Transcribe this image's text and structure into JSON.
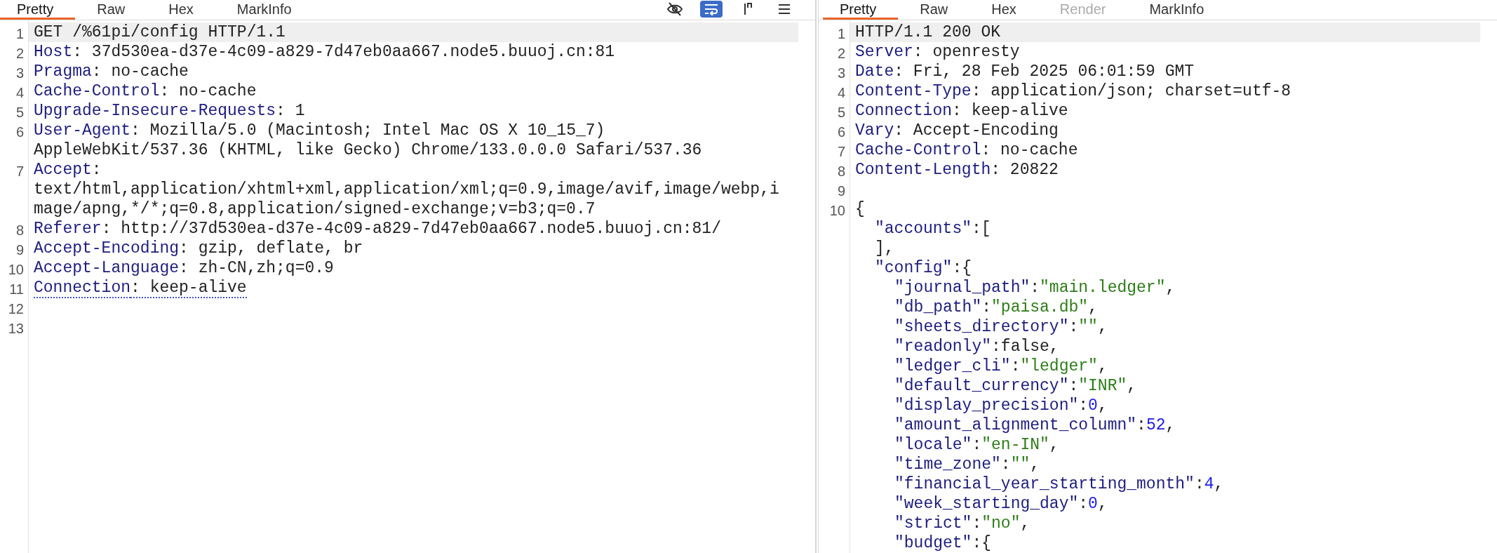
{
  "request": {
    "tabs": [
      {
        "label": "Pretty",
        "selected": true,
        "disabled": false
      },
      {
        "label": "Raw",
        "selected": false,
        "disabled": false
      },
      {
        "label": "Hex",
        "selected": false,
        "disabled": false
      },
      {
        "label": "MarkInfo",
        "selected": false,
        "disabled": false
      }
    ],
    "toolbar": [
      {
        "kind": "hide",
        "on": false
      },
      {
        "kind": "wrap",
        "on": true
      },
      {
        "kind": "newline",
        "on": false
      },
      {
        "kind": "menu",
        "on": false
      }
    ],
    "lines": [
      {
        "number": "1",
        "current": true,
        "underlined": false,
        "tokens": [
          {
            "text": "GET /%61pi/config HTTP/1.1",
            "kind": "plain"
          }
        ]
      },
      {
        "number": "2",
        "current": false,
        "underlined": false,
        "tokens": [
          {
            "text": "Host",
            "kind": "key"
          },
          {
            "text": ": 37d530ea-d37e-4c09-a829-7d47eb0aa667.node5.buuoj.cn:81",
            "kind": "plain"
          }
        ]
      },
      {
        "number": "3",
        "current": false,
        "underlined": false,
        "tokens": [
          {
            "text": "Pragma",
            "kind": "key"
          },
          {
            "text": ": no-cache",
            "kind": "plain"
          }
        ]
      },
      {
        "number": "4",
        "current": false,
        "underlined": false,
        "tokens": [
          {
            "text": "Cache-Control",
            "kind": "key"
          },
          {
            "text": ": no-cache",
            "kind": "plain"
          }
        ]
      },
      {
        "number": "5",
        "current": false,
        "underlined": false,
        "tokens": [
          {
            "text": "Upgrade-Insecure-Requests",
            "kind": "key"
          },
          {
            "text": ": 1",
            "kind": "plain"
          }
        ]
      },
      {
        "number": "6",
        "current": false,
        "underlined": false,
        "tokens": [
          {
            "text": "User-Agent",
            "kind": "key"
          },
          {
            "text": ": Mozilla/5.0 (Macintosh; Intel Mac OS X 10_15_7) AppleWebKit/537.36 (KHTML, like Gecko) Chrome/133.0.0.0 Safari/537.36",
            "kind": "plain"
          }
        ]
      },
      {
        "number": "7",
        "current": false,
        "underlined": false,
        "tokens": [
          {
            "text": "Accept",
            "kind": "key"
          },
          {
            "text": ": text/html,application/xhtml+xml,application/xml;q=0.9,image/avif,image/webp,image/apng,*/*;q=0.8,application/signed-exchange;v=b3;q=0.7",
            "kind": "plain"
          }
        ]
      },
      {
        "number": "8",
        "current": false,
        "underlined": false,
        "tokens": [
          {
            "text": "Referer",
            "kind": "key"
          },
          {
            "text": ": http://37d530ea-d37e-4c09-a829-7d47eb0aa667.node5.buuoj.cn:81/",
            "kind": "plain"
          }
        ]
      },
      {
        "number": "9",
        "current": false,
        "underlined": false,
        "tokens": [
          {
            "text": "Accept-Encoding",
            "kind": "key"
          },
          {
            "text": ": gzip, deflate, br",
            "kind": "plain"
          }
        ]
      },
      {
        "number": "10",
        "current": false,
        "underlined": false,
        "tokens": [
          {
            "text": "Accept-Language",
            "kind": "key"
          },
          {
            "text": ": zh-CN,zh;q=0.9",
            "kind": "plain"
          }
        ]
      },
      {
        "number": "11",
        "current": false,
        "underlined": true,
        "tokens": [
          {
            "text": "Connection",
            "kind": "key"
          },
          {
            "text": ": keep-alive",
            "kind": "plain"
          }
        ]
      },
      {
        "number": "12"
      },
      {
        "number": "13"
      }
    ]
  },
  "response": {
    "tabs": [
      {
        "label": "Pretty",
        "selected": true,
        "disabled": false
      },
      {
        "label": "Raw",
        "selected": false,
        "disabled": false
      },
      {
        "label": "Hex",
        "selected": false,
        "disabled": false
      },
      {
        "label": "Render",
        "selected": false,
        "disabled": true
      },
      {
        "label": "MarkInfo",
        "selected": false,
        "disabled": false
      }
    ],
    "lines": [
      {
        "number": "1",
        "current": true,
        "tokens": [
          {
            "text": "HTTP/1.1 200 OK",
            "kind": "plain"
          }
        ]
      },
      {
        "number": "2",
        "current": false,
        "tokens": [
          {
            "text": "Server",
            "kind": "key"
          },
          {
            "text": ": openresty",
            "kind": "plain"
          }
        ]
      },
      {
        "number": "3",
        "current": false,
        "tokens": [
          {
            "text": "Date",
            "kind": "key"
          },
          {
            "text": ": Fri, 28 Feb 2025 06:01:59 GMT",
            "kind": "plain"
          }
        ]
      },
      {
        "number": "4",
        "current": false,
        "tokens": [
          {
            "text": "Content-Type",
            "kind": "key"
          },
          {
            "text": ": application/json; charset=utf-8",
            "kind": "plain"
          }
        ]
      },
      {
        "number": "5",
        "current": false,
        "tokens": [
          {
            "text": "Connection",
            "kind": "key"
          },
          {
            "text": ": keep-alive",
            "kind": "plain"
          }
        ]
      },
      {
        "number": "6",
        "current": false,
        "tokens": [
          {
            "text": "Vary",
            "kind": "key"
          },
          {
            "text": ": Accept-Encoding",
            "kind": "plain"
          }
        ]
      },
      {
        "number": "7",
        "current": false,
        "tokens": [
          {
            "text": "Cache-Control",
            "kind": "key"
          },
          {
            "text": ": no-cache",
            "kind": "plain"
          }
        ]
      },
      {
        "number": "8",
        "current": false,
        "tokens": [
          {
            "text": "Content-Length",
            "kind": "key"
          },
          {
            "text": ": 20822",
            "kind": "plain"
          }
        ]
      },
      {
        "number": "9"
      }
    ],
    "body": {
      "number": "10",
      "tokens": [
        {
          "text": "{",
          "kind": "plain"
        }
      ],
      "children": [
        {
          "tokens": [
            {
              "text": "\"accounts\"",
              "kind": "key"
            },
            {
              "text": ":[",
              "kind": "plain"
            }
          ]
        },
        {
          "tokens": [
            {
              "text": "],",
              "kind": "plain"
            }
          ]
        },
        {
          "tokens": [
            {
              "text": "\"config\"",
              "kind": "key"
            },
            {
              "text": ":{",
              "kind": "plain"
            }
          ],
          "children": [
            {
              "tokens": [
                {
                  "text": "\"journal_path\"",
                  "kind": "key"
                },
                {
                  "text": ":",
                  "kind": "plain"
                },
                {
                  "text": "\"main.ledger\"",
                  "kind": "string"
                },
                {
                  "text": ",",
                  "kind": "plain"
                }
              ]
            },
            {
              "tokens": [
                {
                  "text": "\"db_path\"",
                  "kind": "key"
                },
                {
                  "text": ":",
                  "kind": "plain"
                },
                {
                  "text": "\"paisa.db\"",
                  "kind": "string"
                },
                {
                  "text": ",",
                  "kind": "plain"
                }
              ]
            },
            {
              "tokens": [
                {
                  "text": "\"sheets_directory\"",
                  "kind": "key"
                },
                {
                  "text": ":",
                  "kind": "plain"
                },
                {
                  "text": "\"\"",
                  "kind": "string"
                },
                {
                  "text": ",",
                  "kind": "plain"
                }
              ]
            },
            {
              "tokens": [
                {
                  "text": "\"readonly\"",
                  "kind": "key"
                },
                {
                  "text": ":false,",
                  "kind": "plain"
                }
              ]
            },
            {
              "tokens": [
                {
                  "text": "\"ledger_cli\"",
                  "kind": "key"
                },
                {
                  "text": ":",
                  "kind": "plain"
                },
                {
                  "text": "\"ledger\"",
                  "kind": "string"
                },
                {
                  "text": ",",
                  "kind": "plain"
                }
              ]
            },
            {
              "tokens": [
                {
                  "text": "\"default_currency\"",
                  "kind": "key"
                },
                {
                  "text": ":",
                  "kind": "plain"
                },
                {
                  "text": "\"INR\"",
                  "kind": "string"
                },
                {
                  "text": ",",
                  "kind": "plain"
                }
              ]
            },
            {
              "tokens": [
                {
                  "text": "\"display_precision\"",
                  "kind": "key"
                },
                {
                  "text": ":",
                  "kind": "plain"
                },
                {
                  "text": "0",
                  "kind": "number"
                },
                {
                  "text": ",",
                  "kind": "plain"
                }
              ]
            },
            {
              "tokens": [
                {
                  "text": "\"amount_alignment_column\"",
                  "kind": "key"
                },
                {
                  "text": ":",
                  "kind": "plain"
                },
                {
                  "text": "52",
                  "kind": "number"
                },
                {
                  "text": ",",
                  "kind": "plain"
                }
              ]
            },
            {
              "tokens": [
                {
                  "text": "\"locale\"",
                  "kind": "key"
                },
                {
                  "text": ":",
                  "kind": "plain"
                },
                {
                  "text": "\"en-IN\"",
                  "kind": "string"
                },
                {
                  "text": ",",
                  "kind": "plain"
                }
              ]
            },
            {
              "tokens": [
                {
                  "text": "\"time_zone\"",
                  "kind": "key"
                },
                {
                  "text": ":",
                  "kind": "plain"
                },
                {
                  "text": "\"\"",
                  "kind": "string"
                },
                {
                  "text": ",",
                  "kind": "plain"
                }
              ]
            },
            {
              "tokens": [
                {
                  "text": "\"financial_year_starting_month\"",
                  "kind": "key"
                },
                {
                  "text": ":",
                  "kind": "plain"
                },
                {
                  "text": "4",
                  "kind": "number"
                },
                {
                  "text": ",",
                  "kind": "plain"
                }
              ]
            },
            {
              "tokens": [
                {
                  "text": "\"week_starting_day\"",
                  "kind": "key"
                },
                {
                  "text": ":",
                  "kind": "plain"
                },
                {
                  "text": "0",
                  "kind": "number"
                },
                {
                  "text": ",",
                  "kind": "plain"
                }
              ]
            },
            {
              "tokens": [
                {
                  "text": "\"strict\"",
                  "kind": "key"
                },
                {
                  "text": ":",
                  "kind": "plain"
                },
                {
                  "text": "\"no\"",
                  "kind": "string"
                },
                {
                  "text": ",",
                  "kind": "plain"
                }
              ]
            },
            {
              "tokens": [
                {
                  "text": "\"budget\"",
                  "kind": "key"
                },
                {
                  "text": ":{",
                  "kind": "plain"
                }
              ]
            }
          ]
        }
      ]
    }
  }
}
